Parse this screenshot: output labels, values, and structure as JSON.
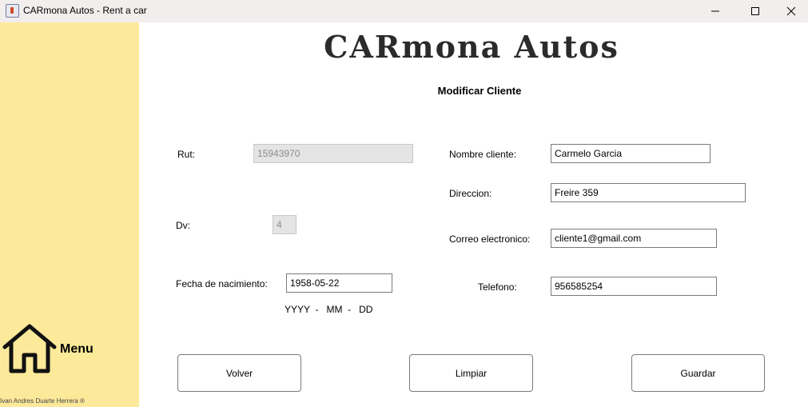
{
  "window": {
    "title": "CARmona Autos - Rent a car",
    "controls": {
      "minimize": "minimize-icon",
      "maximize": "maximize-icon",
      "close": "close-icon"
    }
  },
  "sidebar": {
    "background": "#fde99a",
    "menu_icon": "home-icon",
    "menu_label": "Menu",
    "credit": "Ivan Andres Duarte Herrera ®"
  },
  "header": {
    "brand": "CARmona Autos",
    "subtitle": "Modificar Cliente"
  },
  "form": {
    "rut": {
      "label": "Rut:",
      "value": "15943970",
      "disabled": true
    },
    "dv": {
      "label": "Dv:",
      "value": "4",
      "disabled": true
    },
    "fecha": {
      "label": "Fecha de nacimiento:",
      "value": "1958-05-22",
      "hint": "YYYY  -   MM  -   DD"
    },
    "nombre": {
      "label": "Nombre cliente:",
      "value": "Carmelo Garcia"
    },
    "direccion": {
      "label": "Direccion:",
      "value": "Freire 359"
    },
    "correo": {
      "label": "Correo electronico:",
      "value": "cliente1@gmail.com"
    },
    "telefono": {
      "label": "Telefono:",
      "value": "956585254"
    }
  },
  "buttons": {
    "volver": "Volver",
    "limpiar": "Limpiar",
    "guardar": "Guardar"
  }
}
